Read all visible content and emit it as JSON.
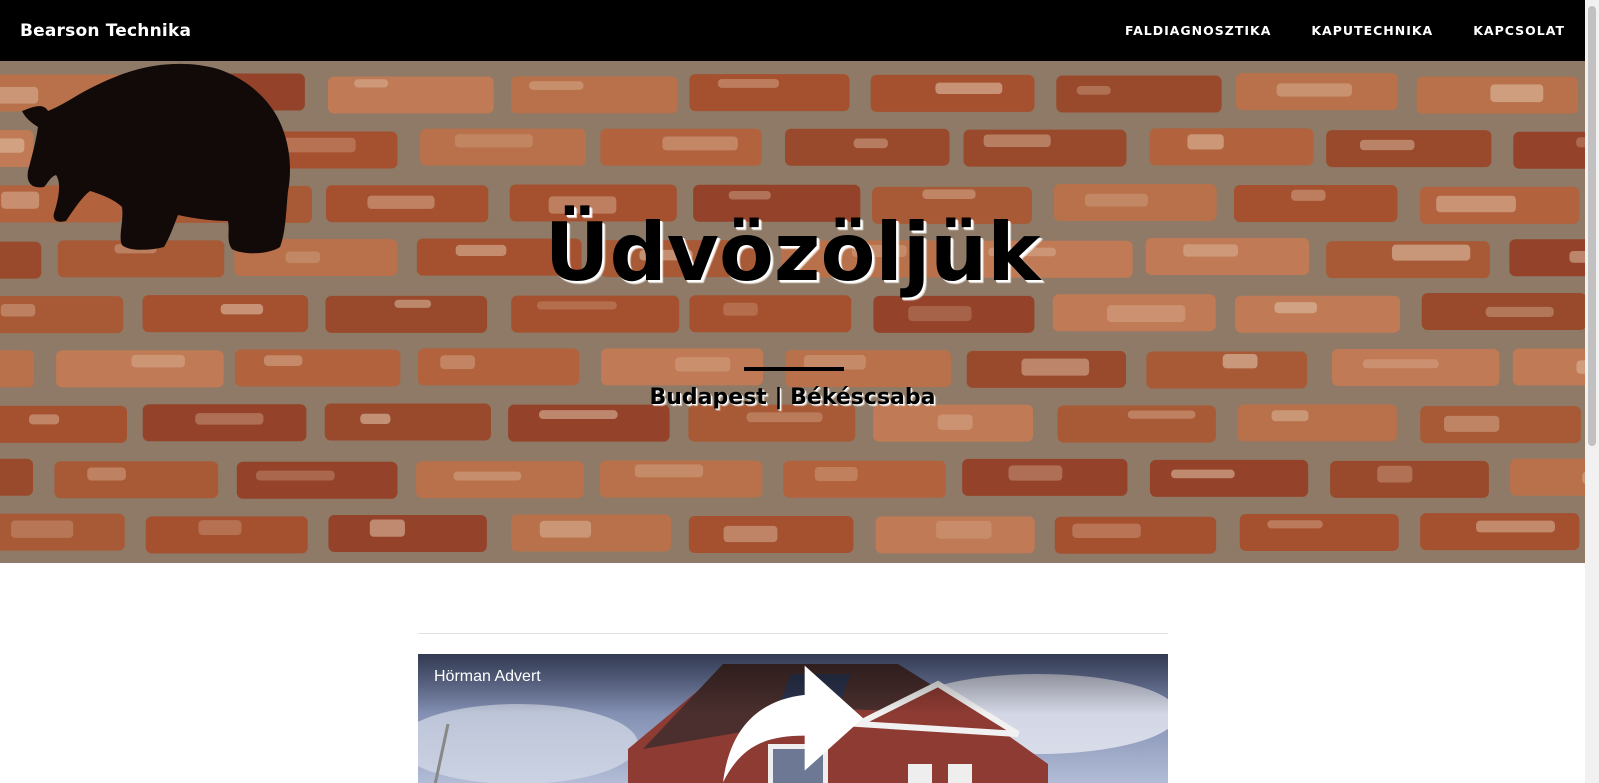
{
  "navbar": {
    "brand": "Bearson Technika",
    "links": [
      "FALDIAGNOSZTIKA",
      "KAPUTECHNIKA",
      "KAPCSOLAT"
    ]
  },
  "hero": {
    "title": "Üdvözöljük",
    "subtitle": "Budapest | Békéscsaba",
    "logo_icon": "bear-silhouette-icon"
  },
  "video": {
    "title": "Hörman Advert",
    "share_icon": "share-arrow-icon"
  },
  "colors": {
    "navbar_bg": "#000000",
    "brick": "#a5502f",
    "mortar": "#8e7a66",
    "text_dark": "#000000"
  }
}
